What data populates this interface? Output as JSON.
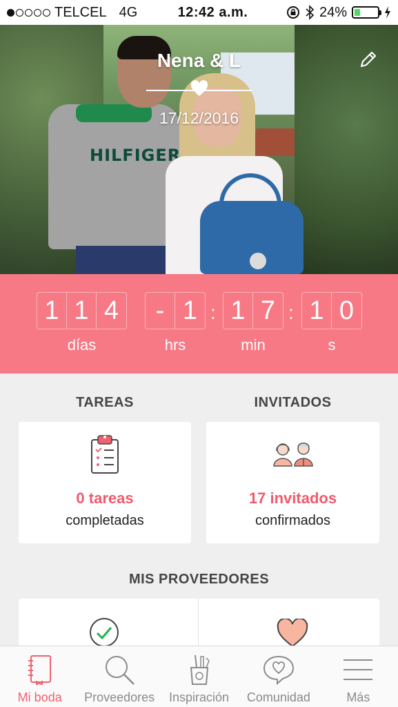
{
  "status_bar": {
    "carrier": "TELCEL",
    "network": "4G",
    "time": "12:42 a.m.",
    "battery": "24%",
    "battery_level": 0.24,
    "signal_bars_filled": 1,
    "signal_bars_total": 5
  },
  "hero": {
    "couple_name": "Nena & L",
    "date": "17/12/2016",
    "shirt_text": "HILFIGER"
  },
  "countdown": {
    "days": [
      "1",
      "1",
      "4"
    ],
    "hours": [
      "-",
      "1"
    ],
    "minutes": [
      "1",
      "7"
    ],
    "seconds": [
      "1",
      "0"
    ],
    "labels": {
      "days": "días",
      "hours": "hrs",
      "minutes": "min",
      "seconds": "s"
    }
  },
  "tasks": {
    "heading": "TAREAS",
    "value": "0 tareas",
    "sub": "completadas",
    "icon": "clipboard-icon"
  },
  "guests": {
    "heading": "INVITADOS",
    "value": "17 invitados",
    "sub": "confirmados",
    "icon": "guests-icon"
  },
  "providers": {
    "heading": "MIS PROVEEDORES",
    "icons": [
      "check-circle-icon",
      "heart-icon"
    ]
  },
  "tabbar": {
    "items": [
      {
        "label": "Mi boda",
        "icon": "notebook-icon",
        "active": true
      },
      {
        "label": "Proveedores",
        "icon": "search-icon",
        "active": false
      },
      {
        "label": "Inspiración",
        "icon": "tools-icon",
        "active": false
      },
      {
        "label": "Comunidad",
        "icon": "chat-heart-icon",
        "active": false
      },
      {
        "label": "Más",
        "icon": "menu-icon",
        "active": false
      }
    ]
  },
  "colors": {
    "accent": "#f77985",
    "accent_text": "#f05a6b",
    "battery": "#4cd964"
  }
}
